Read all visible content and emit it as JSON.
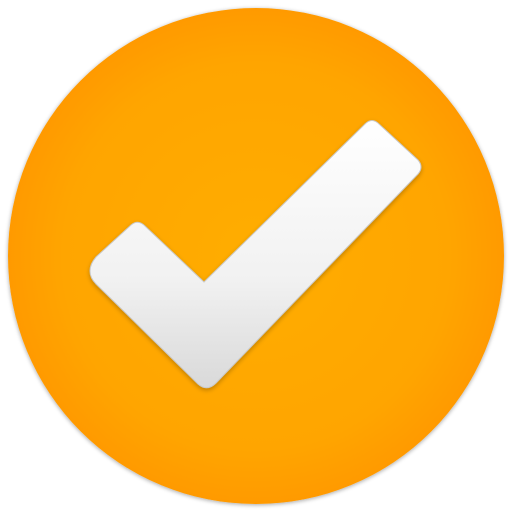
{
  "icon": {
    "name": "check-icon",
    "shape": "circle-with-checkmark",
    "colors": {
      "disc_center": "#ffad00",
      "disc_mid": "#ffa500",
      "disc_edge": "#ff9a00",
      "check_light": "#ffffff",
      "check_mid": "#f1f1f1",
      "check_shade": "#d9d9d9",
      "check_outline": "#c9c9c9"
    }
  }
}
